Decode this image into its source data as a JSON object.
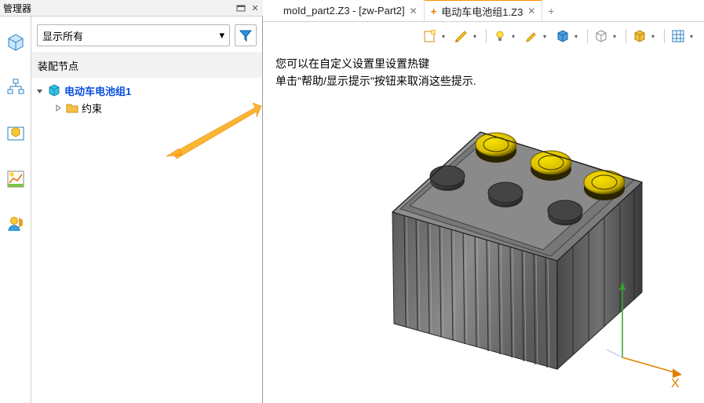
{
  "managerTitle": "管理器",
  "filterText": "显示所有",
  "treeHeader": "装配节点",
  "tree": {
    "root": "电动车电池组1",
    "child": "约束"
  },
  "tabs": {
    "tab1": "moId_part2.Z3 - [zw-Part2]",
    "tab2Prefix": "+",
    "tab2": " 电动车电池组1.Z3"
  },
  "hints": {
    "line1": "您可以在自定义设置里设置热键",
    "line2": "单击\"帮助/显示提示\"按钮来取消这些提示."
  },
  "axis": "X"
}
